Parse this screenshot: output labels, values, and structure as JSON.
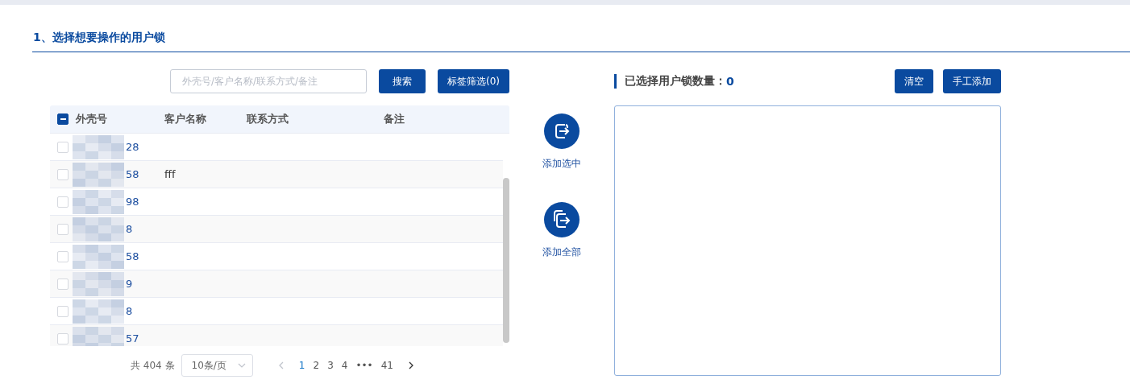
{
  "section_title": "1、选择想要操作的用户锁",
  "search": {
    "placeholder": "外壳号/客户名称/联系方式/备注"
  },
  "buttons": [
    {
      "label": "搜索"
    },
    {
      "label": "标签筛选(0)"
    }
  ],
  "table": {
    "header_checkbox": {
      "indeterminate": true
    },
    "columns": [
      "外壳号",
      "客户名称",
      "联系方式",
      "备注"
    ],
    "rows": [
      {
        "checked": false,
        "id": "28",
        "name": ""
      },
      {
        "checked": false,
        "id": "58",
        "name": "fff"
      },
      {
        "checked": false,
        "id": "98",
        "name": ""
      },
      {
        "checked": false,
        "id": "8",
        "name": ""
      },
      {
        "checked": false,
        "id": "58",
        "name": ""
      },
      {
        "checked": false,
        "id": "9",
        "name": ""
      },
      {
        "checked": false,
        "id": "8",
        "name": ""
      },
      {
        "checked": false,
        "id": "57",
        "name": ""
      }
    ]
  },
  "pagination": {
    "total": "共 404 条",
    "page_size": "10条/页",
    "pages": [
      {
        "label": "1",
        "selected": true
      },
      {
        "label": "2",
        "selected": false
      },
      {
        "label": "3",
        "selected": false
      },
      {
        "label": "4",
        "selected": false
      },
      {
        "label": "•••",
        "selected": false
      },
      {
        "label": "41",
        "selected": false
      }
    ]
  },
  "transfer_actions": [
    {
      "kind": "single",
      "label": "添加选中"
    },
    {
      "kind": "multi",
      "label": "添加全部"
    }
  ],
  "selected_panel": {
    "title": "已选择用户锁数量：",
    "count": "0",
    "buttons": [
      {
        "label": "清空"
      },
      {
        "label": "手工添加"
      }
    ]
  }
}
